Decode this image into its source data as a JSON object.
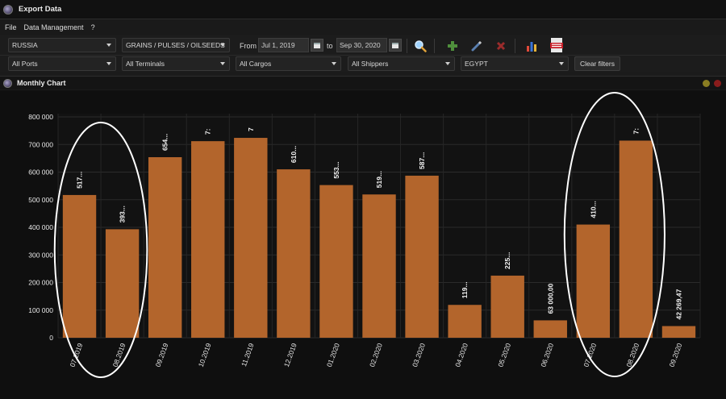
{
  "window": {
    "title": "Export Data"
  },
  "menu": {
    "items": [
      "File",
      "Data Management",
      "?"
    ]
  },
  "filters": {
    "country": "RUSSIA",
    "category": "GRAINS / PULSES / OILSEEDS",
    "from_label": "From",
    "from_date": "Jul 1, 2019",
    "to_label": "to",
    "to_date": "Sep 30, 2020",
    "ports": "All Ports",
    "terminals": "All Terminals",
    "cargos": "All Cargos",
    "shippers": "All Shippers",
    "destination": "EGYPT",
    "clear_label": "Clear filters"
  },
  "toolbar_icons": [
    "search-icon",
    "add-icon",
    "edit-icon",
    "delete-icon",
    "chart-icon",
    "excel-export-icon"
  ],
  "panel": {
    "title": "Monthly Chart"
  },
  "colors": {
    "bar": "#b3652c",
    "ellipse": "#ffffff",
    "background": "#0f0f0f"
  },
  "chart_data": {
    "type": "bar",
    "categories": [
      "07.2019",
      "08.2019",
      "09.2019",
      "10.2019",
      "11.2019",
      "12.2019",
      "01.2020",
      "02.2020",
      "03.2020",
      "04.2020",
      "05.2020",
      "06.2020",
      "07.2020",
      "08.2020",
      "09.2020"
    ],
    "tick_labels": [
      "07.2019",
      "08.2019",
      "09.2019",
      "10.2019",
      "11.2019",
      "12.2019",
      "01.2020",
      "02.2020",
      "03.2020",
      "04.2020",
      "05.2020",
      "06.2020",
      "07.2020",
      "08.2020",
      "09.2020"
    ],
    "values": [
      517000,
      393000,
      654000,
      712000,
      724000,
      610000,
      553000,
      519000,
      587000,
      119000,
      225000,
      63000,
      410000,
      714000,
      42269.47
    ],
    "data_labels": [
      "517...",
      "393...",
      "654...",
      "7:",
      "7",
      "610...",
      "553...",
      "519...",
      "587...",
      "119...",
      "225...",
      "63 000,00",
      "410...",
      "7:",
      "42 269,47"
    ],
    "y_ticks": [
      "0",
      "100 000",
      "200 000",
      "300 000",
      "400 000",
      "500 000",
      "600 000",
      "700 000",
      "800 000"
    ],
    "ylim": [
      0,
      800000
    ],
    "grid": true,
    "title": "",
    "xlabel": "",
    "ylabel": ""
  }
}
